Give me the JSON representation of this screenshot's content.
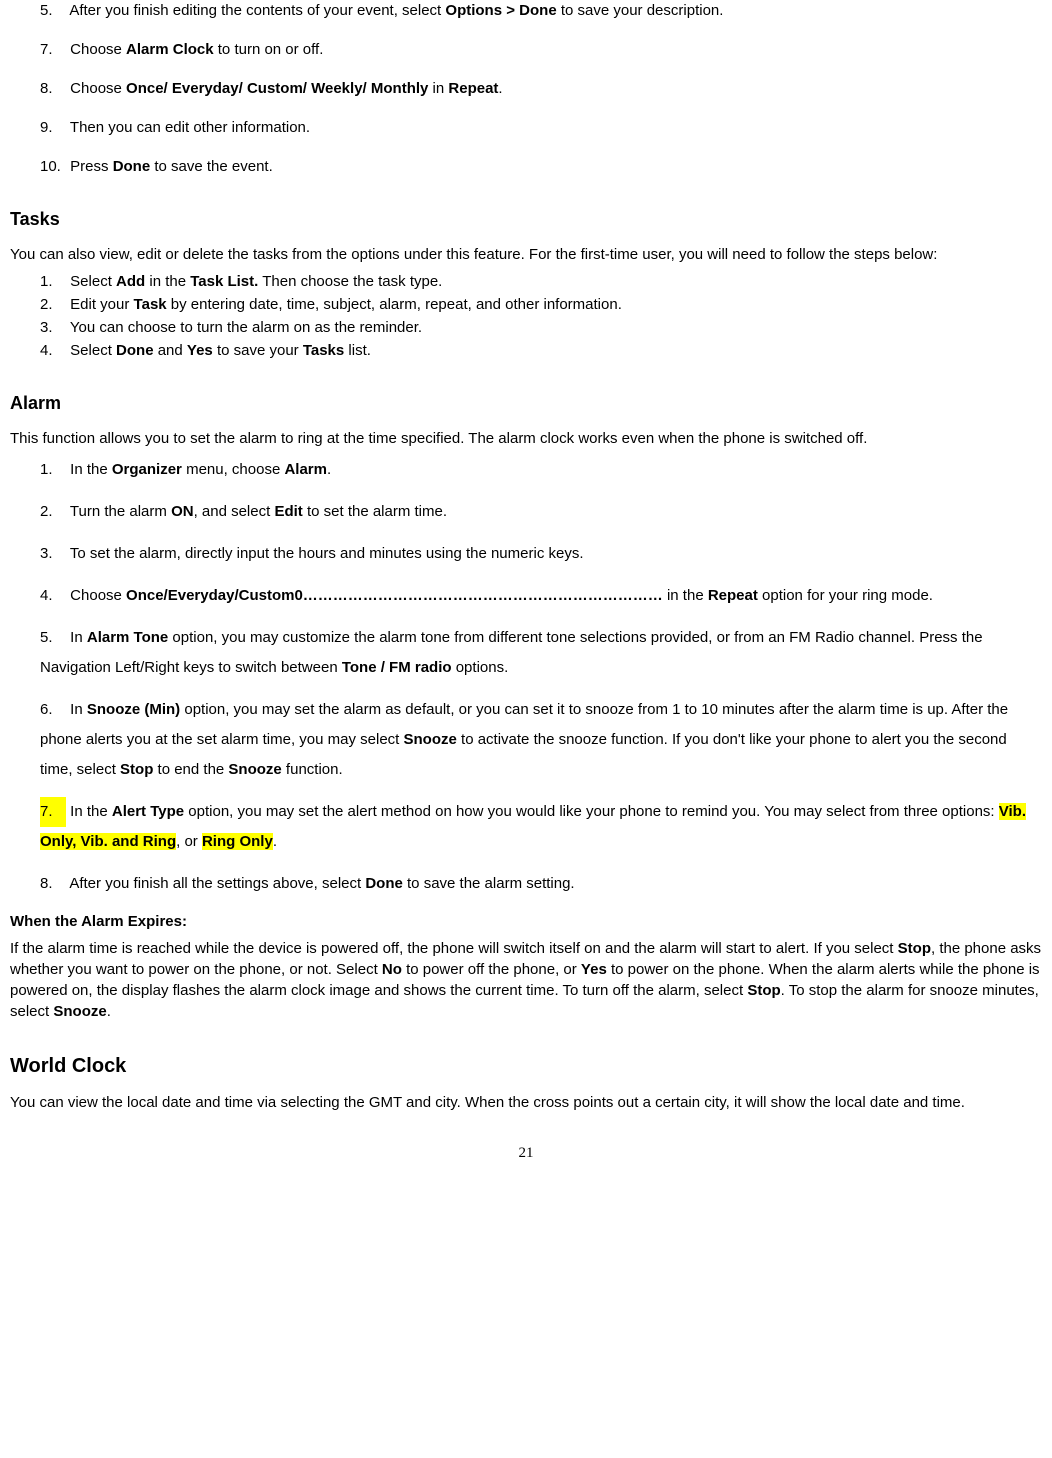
{
  "event_steps": {
    "s5": {
      "num": "5.",
      "pre": "After you finish editing the contents of your event, select ",
      "bold": "Options > Done",
      "post": " to save your description."
    },
    "s7": {
      "num": "7.",
      "pre": "Choose ",
      "bold": "Alarm Clock",
      "post": " to turn on or off."
    },
    "s8": {
      "num": "8.",
      "pre": "Choose ",
      "bold1": "Once/ Everyday/ Custom/ Weekly/ Monthly",
      "mid": " in ",
      "bold2": "Repeat",
      "post": "."
    },
    "s9": {
      "num": "9.",
      "text": "Then you can edit other information."
    },
    "s10": {
      "num": "10.",
      "pre": "Press ",
      "bold": "Done",
      "post": " to save the event."
    }
  },
  "tasks": {
    "heading": "Tasks",
    "intro": "You can also view, edit or delete the tasks from the options under this feature. For the first-time user, you will need to follow the steps below:",
    "s1": {
      "num": "1.",
      "pre": "Select ",
      "bold1": "Add",
      "mid": " in the ",
      "bold2": "Task List.",
      "post": " Then choose the task type."
    },
    "s2": {
      "num": "2.",
      "pre": "Edit your ",
      "bold": "Task",
      "post": " by entering date, time, subject, alarm, repeat, and other information."
    },
    "s3": {
      "num": "3.",
      "text": "You can choose to turn the alarm on as the reminder."
    },
    "s4": {
      "num": "4.",
      "pre": "Select ",
      "bold1": "Done",
      "mid1": " and ",
      "bold2": "Yes",
      "mid2": " to save your ",
      "bold3": "Tasks",
      "post": " list."
    }
  },
  "alarm": {
    "heading": "Alarm",
    "intro": "This function allows you to set the alarm to ring at the time specified. The alarm clock works even when the phone is switched off.",
    "s1": {
      "num": "1.",
      "pre": "In the ",
      "bold1": "Organizer",
      "mid": " menu, choose ",
      "bold2": "Alarm",
      "post": "."
    },
    "s2": {
      "num": "2.",
      "pre": "Turn the alarm ",
      "bold1": "ON",
      "mid": ", and select ",
      "bold2": "Edit",
      "post": " to set the alarm time."
    },
    "s3": {
      "num": "3.",
      "text": "To set the alarm, directly input the hours and minutes using the numeric keys."
    },
    "s4": {
      "num": "4.",
      "pre": "Choose ",
      "bold1": "Once/Everyday/Custom0………………………………………………………………",
      "mid": " in the ",
      "bold2": "Repeat",
      "post": " option for your ring mode."
    },
    "s5": {
      "num": "5.",
      "pre": "In ",
      "bold1": "Alarm Tone",
      "mid": " option, you may customize the alarm tone from different tone selections provided, or from an FM Radio channel. Press the Navigation Left/Right keys to switch between ",
      "bold2": "Tone / FM radio",
      "post": " options."
    },
    "s6": {
      "num": "6.",
      "pre": "In ",
      "bold1": "Snooze (Min)",
      "mid1": " option, you may set the alarm as default, or you can set it to snooze from 1 to 10 minutes after the alarm time is up. After the phone alerts you at the set alarm time, you may select ",
      "bold2": "Snooze",
      "mid2": " to activate the snooze function. If you don't like your phone to alert you the second time, select ",
      "bold3": "Stop",
      "mid3": " to end the ",
      "bold4": "Snooze",
      "post": " function."
    },
    "s7": {
      "num": "7.",
      "pre": "In the ",
      "bold1": "Alert Type",
      "mid1": " option, you may set the alert method on how you would like your phone to remind you. You may select from three options: ",
      "hl1": "Vib. Only, Vib. and Ring",
      "mid2": ", or ",
      "hl2": "Ring Only",
      "post": "."
    },
    "s8": {
      "num": "8.",
      "pre": "After you finish all the settings above, select ",
      "bold": "Done",
      "post": " to save the alarm setting."
    }
  },
  "expires": {
    "heading": "When the Alarm Expires:",
    "pre": "If the alarm time is reached while the device is powered off, the phone will switch itself on and the alarm will start to alert. If you select ",
    "b1": "Stop",
    "m1": ", the phone asks whether you want to power on the phone, or not. Select ",
    "b2": "No",
    "m2": " to power off the phone, or ",
    "b3": "Yes",
    "m3": " to power on the phone. When the alarm alerts while the phone is powered on, the display flashes the alarm clock image and shows the current time. To turn off the alarm, select ",
    "b4": "Stop",
    "m4": ". To stop the alarm for snooze minutes, select ",
    "b5": "Snooze",
    "post": "."
  },
  "world_clock": {
    "heading": "World Clock",
    "text": "You can view the local date and time via selecting the GMT and city. When the cross points out a certain city, it will show the local date and time."
  },
  "page_number": "21"
}
